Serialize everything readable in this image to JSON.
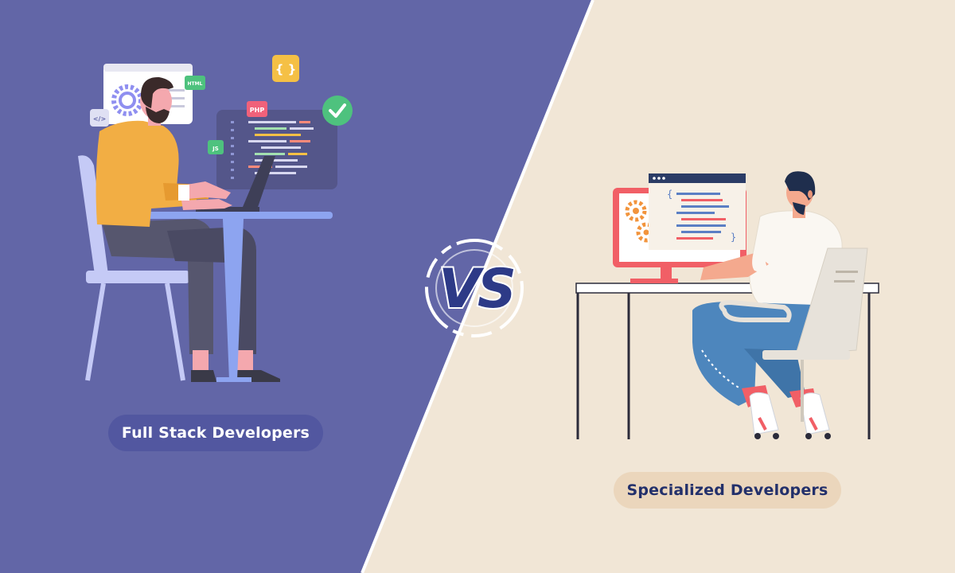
{
  "left_panel": {
    "label": "Full Stack Developers",
    "bg_color": "#6266a7",
    "icons": {
      "html_tag": "HTML",
      "php_tag": "PHP",
      "js_tag": "JS",
      "braces_tag": "{ }",
      "code_tag": "</>"
    }
  },
  "right_panel": {
    "label": "Specialized Developers",
    "bg_color": "#f1e6d6",
    "code_braces": {
      "open": "{",
      "close": "}"
    }
  },
  "vs_badge": {
    "text": "VS",
    "color": "#2d3a87"
  }
}
